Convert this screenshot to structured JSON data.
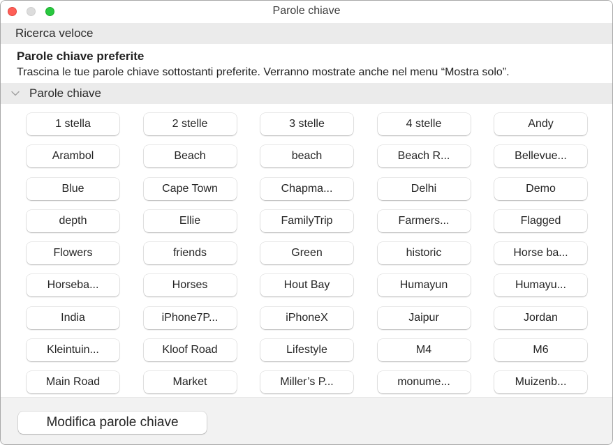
{
  "window": {
    "title": "Parole chiave",
    "controls": [
      "close",
      "minimize",
      "zoom"
    ]
  },
  "quick_search": {
    "label": "Ricerca veloce"
  },
  "favorites": {
    "title": "Parole chiave preferite",
    "description": "Trascina le tue parole chiave sottostanti preferite. Verranno mostrate anche nel menu “Mostra solo”."
  },
  "keywords_section": {
    "label": "Parole chiave",
    "expanded": true,
    "icon": "chevron-down-icon",
    "items": [
      "1 stella",
      "2 stelle",
      "3 stelle",
      "4 stelle",
      "Andy",
      "Arambol",
      "Beach",
      "beach",
      "Beach R...",
      "Bellevue...",
      "Blue",
      "Cape Town",
      "Chapma...",
      "Delhi",
      "Demo",
      "depth",
      "Ellie",
      "FamilyTrip",
      "Farmers...",
      "Flagged",
      "Flowers",
      "friends",
      "Green",
      "historic",
      "Horse ba...",
      "Horseba...",
      "Horses",
      "Hout Bay",
      "Humayun",
      "Humayu...",
      "India",
      "iPhone7P...",
      "iPhoneX",
      "Jaipur",
      "Jordan",
      "Kleintuin...",
      "Kloof Road",
      "Lifestyle",
      "M4",
      "M6",
      "Main Road",
      "Market",
      "Miller’s P...",
      "monume...",
      "Muizenb..."
    ]
  },
  "footer": {
    "edit_button_label": "Modifica parole chiave"
  },
  "colors": {
    "close": "#fe5f57",
    "minimize": "#dcdcdc",
    "zoom": "#28c840",
    "section_header_bg": "#ebebeb",
    "footer_bg": "#f2f2f2"
  }
}
